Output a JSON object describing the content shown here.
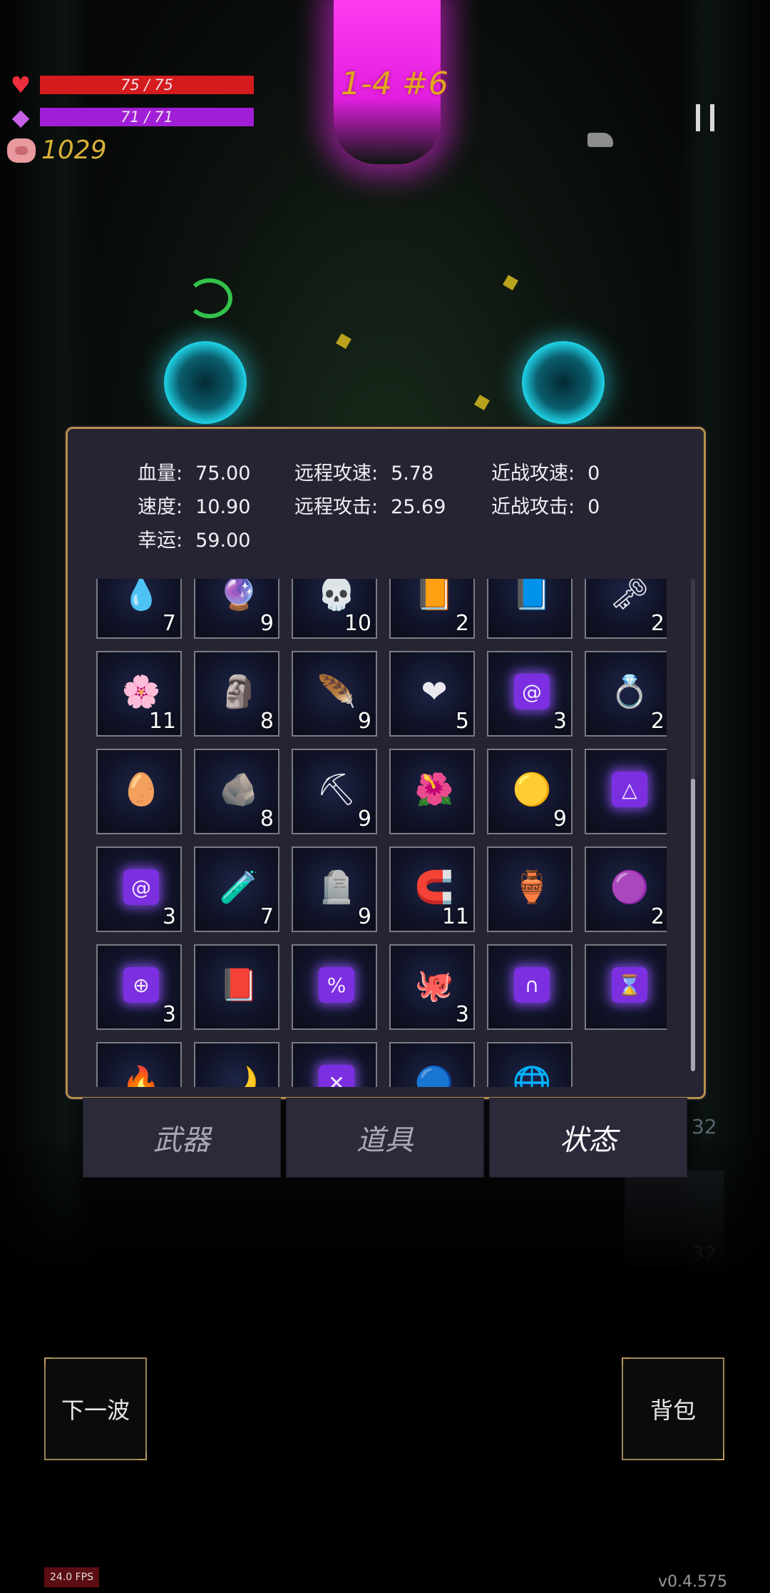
{
  "hud": {
    "hp": {
      "current": 75,
      "max": 75,
      "text": "75 / 75"
    },
    "mp": {
      "current": 71,
      "max": 71,
      "text": "71 / 71"
    },
    "gold": "1029",
    "wave": "1-4 #6"
  },
  "stats": [
    {
      "label": "血量:",
      "value": "75.00"
    },
    {
      "label": "远程攻速:",
      "value": "5.78"
    },
    {
      "label": "近战攻速:",
      "value": "0"
    },
    {
      "label": "速度:",
      "value": "10.90"
    },
    {
      "label": "远程攻击:",
      "value": "25.69"
    },
    {
      "label": "近战攻击:",
      "value": "0"
    },
    {
      "label": "幸运:",
      "value": "59.00"
    }
  ],
  "items": [
    {
      "icon": "water-drop-icon",
      "glyph": "💧",
      "count": "7"
    },
    {
      "icon": "purple-crystal-icon",
      "glyph": "🔮",
      "count": "9"
    },
    {
      "icon": "feathered-skull-icon",
      "glyph": "💀",
      "count": "10"
    },
    {
      "icon": "golden-book-icon",
      "glyph": "📙",
      "count": "2"
    },
    {
      "icon": "blue-tome-icon",
      "glyph": "📘",
      "count": ""
    },
    {
      "icon": "stone-key-icon",
      "glyph": "🗝",
      "count": "2"
    },
    {
      "icon": "flower-garland-icon",
      "glyph": "🌸",
      "count": "11"
    },
    {
      "icon": "hooded-statue-icon",
      "glyph": "🗿",
      "count": "8"
    },
    {
      "icon": "white-feather-icon",
      "glyph": "🪶",
      "count": "9"
    },
    {
      "icon": "burning-heart-icon",
      "glyph": "❤",
      "count": "5"
    },
    {
      "icon": "spiral-rune-icon",
      "glyph": "@",
      "count": "3",
      "rune": true
    },
    {
      "icon": "silver-ring-icon",
      "glyph": "💍",
      "count": "2"
    },
    {
      "icon": "seed-egg-icon",
      "glyph": "🥚",
      "count": ""
    },
    {
      "icon": "grey-stone-icon",
      "glyph": "🪨",
      "count": "8"
    },
    {
      "icon": "ore-chunks-icon",
      "glyph": "⛏",
      "count": "9"
    },
    {
      "icon": "red-flower-icon",
      "glyph": "🌺",
      "count": ""
    },
    {
      "icon": "gold-orb-icon",
      "glyph": "🟡",
      "count": "9"
    },
    {
      "icon": "triangle-rune-icon",
      "glyph": "△",
      "count": "",
      "rune": true
    },
    {
      "icon": "spiral-rune-icon",
      "glyph": "@",
      "count": "3",
      "rune": true
    },
    {
      "icon": "green-potion-icon",
      "glyph": "🧪",
      "count": "7"
    },
    {
      "icon": "tombstone-icon",
      "glyph": "🪦",
      "count": "9"
    },
    {
      "icon": "horseshoe-icon",
      "glyph": "🧲",
      "count": "11"
    },
    {
      "icon": "clay-vase-icon",
      "glyph": "🏺",
      "count": ""
    },
    {
      "icon": "pink-slime-icon",
      "glyph": "🟣",
      "count": "2"
    },
    {
      "icon": "cross-rune-icon",
      "glyph": "⊕",
      "count": "3",
      "rune": true
    },
    {
      "icon": "dark-grimoire-icon",
      "glyph": "📕",
      "count": ""
    },
    {
      "icon": "percent-rune-icon",
      "glyph": "%",
      "count": "",
      "rune": true
    },
    {
      "icon": "octopus-icon",
      "glyph": "🐙",
      "count": "3"
    },
    {
      "icon": "curve-rune-icon",
      "glyph": "∩",
      "count": "",
      "rune": true
    },
    {
      "icon": "hourglass-rune-icon",
      "glyph": "⌛",
      "count": "",
      "rune": true
    },
    {
      "icon": "yellow-flame-icon",
      "glyph": "🔥",
      "count": ""
    },
    {
      "icon": "crescent-horn-icon",
      "glyph": "🌙",
      "count": ""
    },
    {
      "icon": "x-rune-icon",
      "glyph": "✕",
      "count": "",
      "rune": true
    },
    {
      "icon": "blue-orb-icon",
      "glyph": "🔵",
      "count": ""
    },
    {
      "icon": "rainbow-orb-icon",
      "glyph": "🌐",
      "count": ""
    }
  ],
  "tabs": [
    {
      "label": "武器",
      "active": false
    },
    {
      "label": "道具",
      "active": false
    },
    {
      "label": "状态",
      "active": true
    }
  ],
  "buttons": {
    "next_wave": "下一波",
    "backpack": "背包"
  },
  "background": {
    "num1": "32",
    "num2": "32"
  },
  "fps": "24.0 FPS",
  "version": "v0.4.575",
  "colors": {
    "panel_bg": "#262433",
    "panel_border": "#b6904d",
    "hp": "#d41b1e",
    "mp": "#a01fd6",
    "gold": "#d9b13a"
  }
}
